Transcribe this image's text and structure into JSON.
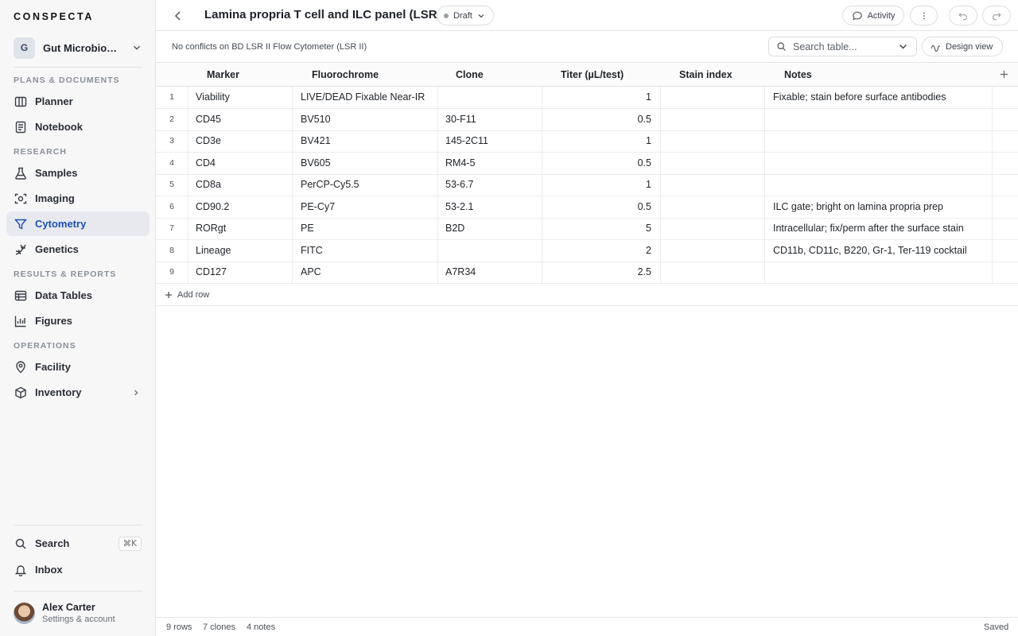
{
  "sidebar": {
    "brand": "CONSPECTA",
    "workspace": {
      "initial": "G",
      "name": "Gut Microbiome..."
    },
    "sections": {
      "plans": "PLANS & DOCUMENTS",
      "research": "RESEARCH",
      "results": "RESULTS & REPORTS",
      "operations": "OPERATIONS"
    },
    "items": {
      "planner": "Planner",
      "notebook": "Notebook",
      "samples": "Samples",
      "imaging": "Imaging",
      "cytometry": "Cytometry",
      "genetics": "Genetics",
      "data_tables": "Data Tables",
      "figures": "Figures",
      "facility": "Facility",
      "inventory": "Inventory"
    },
    "search": {
      "label": "Search",
      "shortcut": "⌘K"
    },
    "inbox": "Inbox",
    "user": {
      "name": "Alex Carter",
      "sub": "Settings & account"
    }
  },
  "header": {
    "title": "Lamina propria T cell and ILC panel (LSR II)",
    "status": "Draft",
    "activity": "Activity"
  },
  "subbar": {
    "conflict": "No conflicts on BD LSR II Flow Cytometer (LSR II)",
    "search_placeholder": "Search table...",
    "design_view": "Design view"
  },
  "table": {
    "columns": [
      "Marker",
      "Fluorochrome",
      "Clone",
      "Titer (µL/test)",
      "Stain index",
      "Notes"
    ],
    "rows": [
      {
        "n": "1",
        "marker": "Viability",
        "fluor": "LIVE/DEAD Fixable Near-IR",
        "clone": "",
        "titer": "1",
        "stain": "",
        "notes": "Fixable; stain before surface antibodies"
      },
      {
        "n": "2",
        "marker": "CD45",
        "fluor": "BV510",
        "clone": "30-F11",
        "titer": "0.5",
        "stain": "",
        "notes": ""
      },
      {
        "n": "3",
        "marker": "CD3e",
        "fluor": "BV421",
        "clone": "145-2C11",
        "titer": "1",
        "stain": "",
        "notes": ""
      },
      {
        "n": "4",
        "marker": "CD4",
        "fluor": "BV605",
        "clone": "RM4-5",
        "titer": "0.5",
        "stain": "",
        "notes": ""
      },
      {
        "n": "5",
        "marker": "CD8a",
        "fluor": "PerCP-Cy5.5",
        "clone": "53-6.7",
        "titer": "1",
        "stain": "",
        "notes": ""
      },
      {
        "n": "6",
        "marker": "CD90.2",
        "fluor": "PE-Cy7",
        "clone": "53-2.1",
        "titer": "0.5",
        "stain": "",
        "notes": "ILC gate; bright on lamina propria prep"
      },
      {
        "n": "7",
        "marker": "RORgt",
        "fluor": "PE",
        "clone": "B2D",
        "titer": "5",
        "stain": "",
        "notes": "Intracellular; fix/perm after the surface stain"
      },
      {
        "n": "8",
        "marker": "Lineage",
        "fluor": "FITC",
        "clone": "",
        "titer": "2",
        "stain": "",
        "notes": "CD11b, CD11c, B220, Gr-1, Ter-119 cocktail"
      },
      {
        "n": "9",
        "marker": "CD127",
        "fluor": "APC",
        "clone": "A7R34",
        "titer": "2.5",
        "stain": "",
        "notes": ""
      }
    ],
    "add_row": "Add row"
  },
  "footer": {
    "rows": "9 rows",
    "clones": "7 clones",
    "notes": "4 notes",
    "status": "Saved"
  }
}
